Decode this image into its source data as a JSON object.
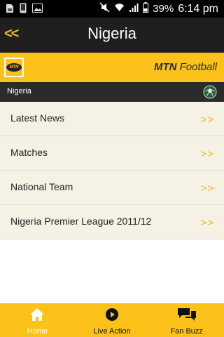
{
  "status_bar": {
    "battery_percent": "39%",
    "time": "6:14 pm",
    "icons": [
      "sim-card-icon",
      "phone-icon",
      "image-icon",
      "no-sound-icon",
      "wifi-icon",
      "signal-icon",
      "battery-icon"
    ]
  },
  "header": {
    "back_label": "<<",
    "title": "Nigeria"
  },
  "brand": {
    "logo_text": "MTN",
    "name_bold": "MTN",
    "name_rest": " Football",
    "color": "#fcc21a"
  },
  "section": {
    "label": "Nigeria"
  },
  "menu": {
    "items": [
      {
        "label": "Latest News",
        "arrow": ">>"
      },
      {
        "label": "Matches",
        "arrow": ">>"
      },
      {
        "label": "National Team",
        "arrow": ">>"
      },
      {
        "label": "Nigeria Premier League 2011/12",
        "arrow": ">>"
      }
    ]
  },
  "tabs": [
    {
      "label": "Home",
      "icon": "home-icon"
    },
    {
      "label": "Live Action",
      "icon": "play-icon"
    },
    {
      "label": "Fan Buzz",
      "icon": "chat-icon"
    }
  ]
}
